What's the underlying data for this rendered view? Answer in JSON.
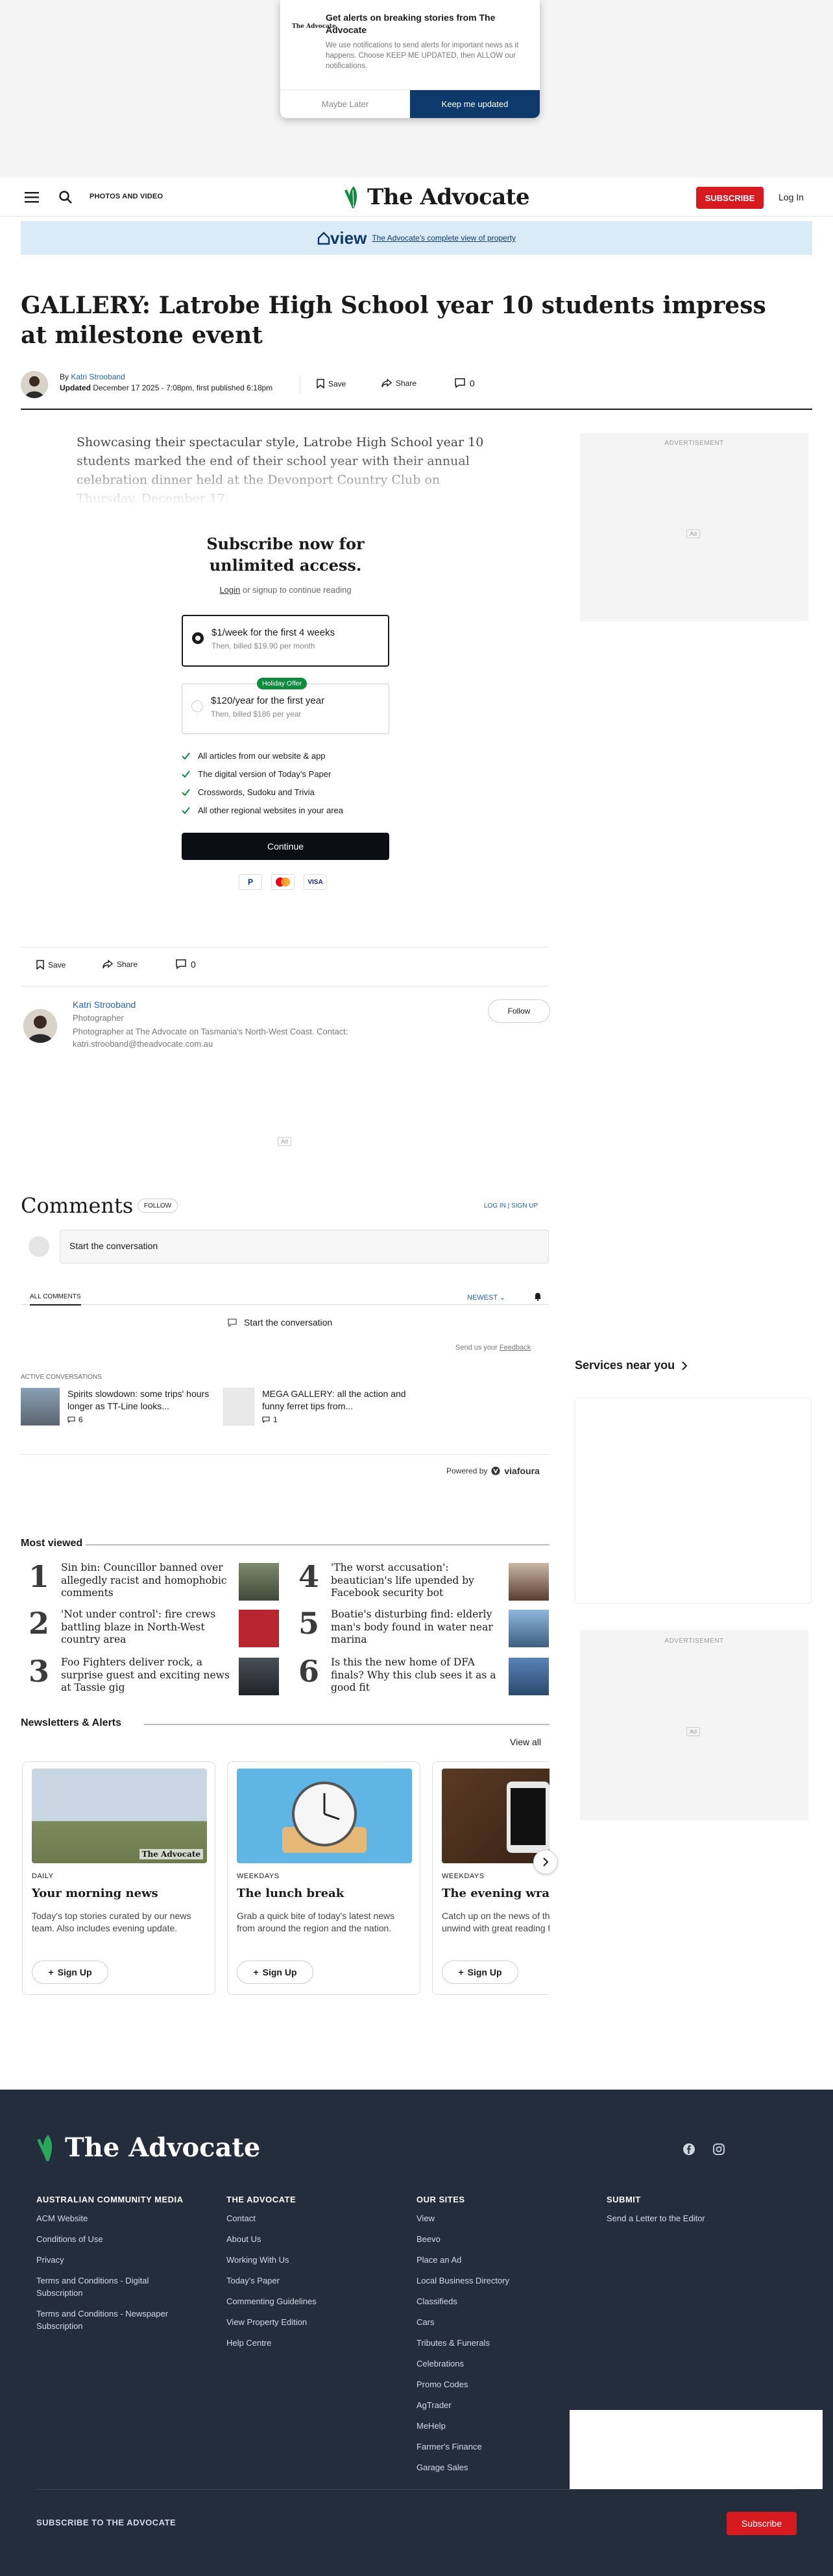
{
  "alert": {
    "logo": "The Advocate",
    "title": "Get alerts on breaking stories from The Advocate",
    "body": "We use notifications to send alerts for important news as it happens. Choose KEEP ME UPDATED, then ALLOW our notifications.",
    "later": "Maybe Later",
    "keep": "Keep me updated"
  },
  "header": {
    "photos": "PHOTOS AND VIDEO",
    "brand": "The Advocate",
    "subscribe": "SUBSCRIBE",
    "login": "Log In"
  },
  "viewbar": {
    "logo": "view",
    "text": "The Advocate's complete view of property"
  },
  "article": {
    "title": "GALLERY: Latrobe High School year 10 students impress at milestone event",
    "by": "By",
    "author": "Katri Strooband",
    "updated_label": "Updated",
    "updated": "December 17 2025 - 7:08pm, first published 6:18pm",
    "save": "Save",
    "share": "Share",
    "comments": "0",
    "lead": "Showcasing their spectacular style, Latrobe High School year 10 students marked the end of their school year with their annual celebration dinner held at the Devonport Country Club on Thursday, December 17."
  },
  "ad": {
    "label": "ADVERTISEMENT",
    "tag": "Ad"
  },
  "paywall": {
    "heading": "Subscribe now for unlimited access.",
    "login": "Login",
    "login_rest": "or signup to continue reading",
    "options": [
      {
        "title": "$1/week for the first 4 weeks",
        "sub": "Then, billed $19.90 per month"
      },
      {
        "title": "$120/year for the first year",
        "sub": "Then, billed $186 per year",
        "badge": "Holiday Offer"
      }
    ],
    "features": [
      "All articles from our website & app",
      "The digital version of Today's Paper",
      "Crosswords, Sudoku and Trivia",
      "All other regional websites in your area"
    ],
    "continue": "Continue",
    "pay": [
      "P",
      "VISA"
    ]
  },
  "author": {
    "name": "Katri Strooband",
    "role": "Photographer",
    "bio": "Photographer at The Advocate on Tasmania's North-West Coast. Contact: katri.strooband@theadvocate.com.au",
    "follow": "Follow"
  },
  "comments": {
    "title": "Comments",
    "follow": "FOLLOW",
    "login": "LOG IN",
    "signup": "SIGN UP",
    "placeholder": "Start the conversation",
    "all": "ALL COMMENTS",
    "newest": "NEWEST",
    "start": "Start the conversation",
    "feedback_pre": "Send us your",
    "feedback": "Feedback",
    "active": "ACTIVE CONVERSATIONS",
    "conversations": [
      {
        "text": "Spirits slowdown: some trips' hours longer as TT-Line looks...",
        "count": "6"
      },
      {
        "text": "MEGA GALLERY: all the action and funny ferret tips from...",
        "count": "1"
      }
    ],
    "powered": "Powered by",
    "brand": "viafoura"
  },
  "services": "Services near you",
  "most_viewed": {
    "title": "Most viewed",
    "items": [
      {
        "n": "1",
        "text": "Sin bin: Councillor banned over allegedly racist and homophobic comments"
      },
      {
        "n": "2",
        "text": "'Not under control': fire crews battling blaze in North-West country area"
      },
      {
        "n": "3",
        "text": "Foo Fighters deliver rock, a surprise guest and exciting news at Tassie gig"
      },
      {
        "n": "4",
        "text": "'The worst accusation': beautician's life upended by Facebook security bot"
      },
      {
        "n": "5",
        "text": "Boatie's disturbing find: elderly man's body found in water near marina"
      },
      {
        "n": "6",
        "text": "Is this the new home of DFA finals? Why this club sees it as a good fit"
      }
    ]
  },
  "newsletters": {
    "title": "Newsletters & Alerts",
    "view_all": "View all",
    "cards": [
      {
        "cat": "DAILY",
        "title": "Your morning news",
        "desc": "Today's top stories curated by our news team. Also includes evening update.",
        "btn": "Sign Up",
        "logo": "The Advocate"
      },
      {
        "cat": "WEEKDAYS",
        "title": "The lunch break",
        "desc": "Grab a quick bite of today's latest news from around the region and the nation.",
        "btn": "Sign Up"
      },
      {
        "cat": "WEEKDAYS",
        "title": "The evening wrap",
        "desc": "Catch up on the news of the day and unwind with great reading for the evening.",
        "btn": "Sign Up"
      }
    ]
  },
  "footer": {
    "brand": "The Advocate",
    "cols": [
      {
        "title": "AUSTRALIAN COMMUNITY MEDIA",
        "links": [
          "ACM Website",
          "Conditions of Use",
          "Privacy",
          "Terms and Conditions - Digital Subscription",
          "Terms and Conditions - Newspaper Subscription"
        ]
      },
      {
        "title": "THE ADVOCATE",
        "links": [
          "Contact",
          "About Us",
          "Working With Us",
          "Today's Paper",
          "Commenting Guidelines",
          "View Property Edition",
          "Help Centre"
        ]
      },
      {
        "title": "OUR SITES",
        "links": [
          "View",
          "Beevo",
          "Place an Ad",
          "Local Business Directory",
          "Classifieds",
          "Cars",
          "Tributes & Funerals",
          "Celebrations",
          "Promo Codes",
          "AgTrader",
          "MeHelp",
          "Farmer's Finance",
          "Garage Sales"
        ]
      },
      {
        "title": "SUBMIT",
        "links": [
          "Send a Letter to the Editor"
        ]
      }
    ],
    "subscribe_label": "SUBSCRIBE TO THE ADVOCATE",
    "subscribe_btn": "Subscribe"
  },
  "colors": {
    "brand_red": "#d71920",
    "navy": "#0d3a6b",
    "footer": "#232d3c",
    "link": "#2563ae",
    "green": "#0d8c3f"
  }
}
